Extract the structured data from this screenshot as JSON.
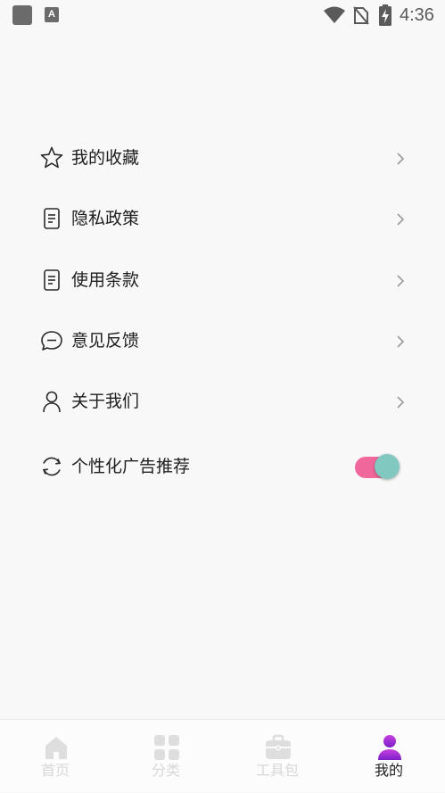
{
  "status_bar": {
    "time": "4:36",
    "app_icon_letter": "A",
    "icons": [
      "notification-square-icon",
      "a-app-icon",
      "wifi-icon",
      "no-sim-icon",
      "battery-charging-icon"
    ]
  },
  "menu": {
    "items": [
      {
        "label": "我的收藏",
        "icon": "star-icon"
      },
      {
        "label": "隐私政策",
        "icon": "document-icon"
      },
      {
        "label": "使用条款",
        "icon": "document-icon"
      },
      {
        "label": "意见反馈",
        "icon": "chat-bubble-icon"
      },
      {
        "label": "关于我们",
        "icon": "person-icon"
      }
    ],
    "toggle_item": {
      "label": "个性化广告推荐",
      "icon": "refresh-icon",
      "enabled": true
    }
  },
  "bottom_nav": {
    "tabs": [
      {
        "label": "首页",
        "icon": "home-icon",
        "active": false
      },
      {
        "label": "分类",
        "icon": "grid-icon",
        "active": false
      },
      {
        "label": "工具包",
        "icon": "toolbox-icon",
        "active": false
      },
      {
        "label": "我的",
        "icon": "user-profile-icon",
        "active": true
      }
    ]
  },
  "colors": {
    "background": "#f8f8f8",
    "toggle_track": "#f0689b",
    "toggle_thumb": "#80c8c0",
    "active_icon_gradient": [
      "#c840e0",
      "#7a20c8"
    ],
    "inactive_nav": "#d8d8d8"
  }
}
